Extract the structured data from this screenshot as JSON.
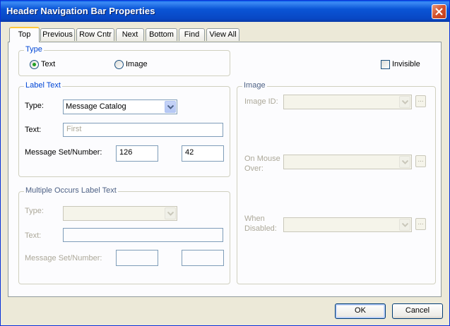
{
  "window": {
    "title": "Header Navigation Bar Properties"
  },
  "tabs": [
    {
      "label": "Top",
      "active": true
    },
    {
      "label": "Previous"
    },
    {
      "label": "Row Cntr"
    },
    {
      "label": "Next"
    },
    {
      "label": "Bottom"
    },
    {
      "label": "Find"
    },
    {
      "label": "View All"
    }
  ],
  "type_group": {
    "title": "Type",
    "text_label": "Text",
    "image_label": "Image",
    "selected": "Text"
  },
  "invisible": {
    "label": "Invisible",
    "checked": false
  },
  "label_text": {
    "title": "Label Text",
    "type_label": "Type:",
    "type_value": "Message Catalog",
    "text_label": "Text:",
    "text_value": "First",
    "msg_label": "Message Set/Number:",
    "msg_set": "126",
    "msg_number": "42"
  },
  "multiple_occurs": {
    "title": "Multiple Occurs Label Text",
    "type_label": "Type:",
    "text_label": "Text:",
    "msg_label": "Message Set/Number:"
  },
  "image_group": {
    "title": "Image",
    "image_id_label": "Image ID:",
    "mouse_over_label_1": "On Mouse",
    "mouse_over_label_2": "Over:",
    "disabled_label_1": "When",
    "disabled_label_2": "Disabled:",
    "ellipsis": "..."
  },
  "buttons": {
    "ok": "OK",
    "cancel": "Cancel"
  },
  "colors": {
    "title_bar": "#0a55d6",
    "group_title": "#0046d5",
    "radio_dot": "#21a121",
    "tab_highlight": "#ffc83c"
  }
}
